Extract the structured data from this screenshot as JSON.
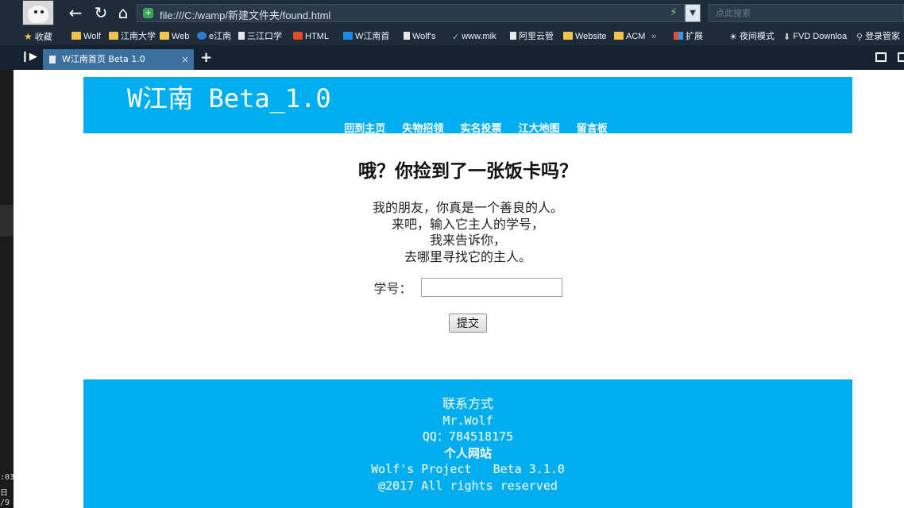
{
  "browser": {
    "url": "file:///C:/wamp/新建文件夹/found.html",
    "search_placeholder": "点此搜索",
    "bookmarks": [
      {
        "label": "收藏",
        "type": "star"
      },
      {
        "label": "Wolf",
        "type": "folder"
      },
      {
        "label": "江南大学",
        "type": "folder"
      },
      {
        "label": "Web",
        "type": "folder"
      },
      {
        "label": "e江南",
        "type": "ie"
      },
      {
        "label": "三江口学",
        "type": "page"
      },
      {
        "label": "HTML",
        "type": "html"
      },
      {
        "label": "W江南首",
        "type": "w"
      },
      {
        "label": "Wolf's",
        "type": "page"
      },
      {
        "label": "www.mik",
        "type": "check"
      },
      {
        "label": "阿里云管",
        "type": "page"
      },
      {
        "label": "Website",
        "type": "folder"
      },
      {
        "label": "ACM",
        "type": "folder"
      },
      {
        "label": "»",
        "type": "more"
      },
      {
        "label": "扩展",
        "type": "ext"
      },
      {
        "label": "夜间模式",
        "type": "night"
      },
      {
        "label": "FVD Downloa",
        "type": "download"
      },
      {
        "label": "登录管家",
        "type": "login"
      }
    ],
    "tab": {
      "title": "W江南首页 Beta 1.0",
      "close": "×"
    },
    "new_tab": "+"
  },
  "site": {
    "title": "W江南 Beta_1.0",
    "nav": [
      "回到主页",
      "失物招领",
      "实名投票",
      "江大地图",
      "留言板"
    ]
  },
  "main": {
    "heading": "哦？你捡到了一张饭卡吗？",
    "intro_lines": [
      "我的朋友，你真是一个善良的人。",
      "来吧，输入它主人的学号，",
      "我来告诉你，",
      "去哪里寻找它的主人。"
    ],
    "id_label": "学号：",
    "id_value": "",
    "submit_label": "提交"
  },
  "footer": {
    "contact_title": "联系方式",
    "name": "Mr.Wolf",
    "qq": "QQ：784518175",
    "site_title": "个人网站",
    "project": "Wolf's Project   Beta 3.1.0",
    "copyright": "@2017 All rights reserved"
  },
  "left_strip": {
    "time": ":03",
    "day": "日",
    "date": "/9"
  },
  "colors": {
    "accent": "#00aeef",
    "browser_bg": "#1e2b3a"
  }
}
